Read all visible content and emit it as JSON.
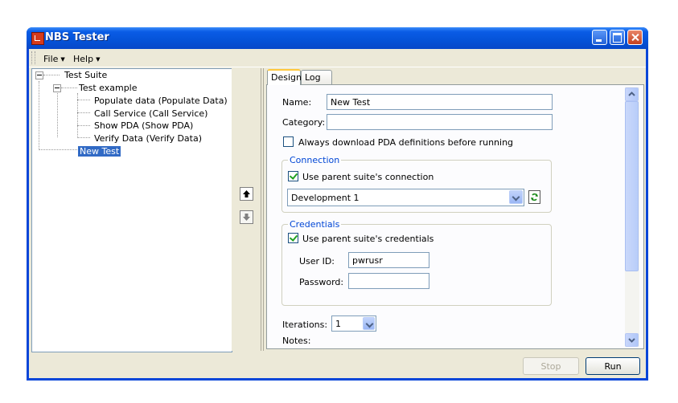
{
  "window": {
    "title": "NBS Tester"
  },
  "menubar": {
    "file": "File",
    "help": "Help"
  },
  "tree": {
    "root": "Test Suite",
    "group": "Test example",
    "items": [
      "Populate data (Populate Data)",
      "Call Service (Call Service)",
      "Show PDA (Show PDA)",
      "Verify Data (Verify Data)"
    ],
    "selected": "New Test"
  },
  "tabs": {
    "design": "Design",
    "log": "Log"
  },
  "form": {
    "name_label": "Name:",
    "name_value": "New Test",
    "category_label": "Category:",
    "category_value": "",
    "always_download_label": "Always download PDA definitions before running",
    "always_download_checked": false,
    "connection": {
      "title": "Connection",
      "use_parent_label": "Use parent suite's connection",
      "use_parent_checked": true,
      "selected": "Development 1"
    },
    "credentials": {
      "title": "Credentials",
      "use_parent_label": "Use parent suite's credentials",
      "use_parent_checked": true,
      "user_id_label": "User ID:",
      "user_id_value": "pwrusr",
      "password_label": "Password:",
      "password_value": ""
    },
    "iterations_label": "Iterations:",
    "iterations_value": "1",
    "notes_label": "Notes:"
  },
  "buttons": {
    "stop": "Stop",
    "run": "Run"
  },
  "icons": [
    "app-icon",
    "minimize-icon",
    "maximize-icon",
    "close-icon",
    "move-up-icon",
    "move-down-icon",
    "refresh-icon"
  ]
}
